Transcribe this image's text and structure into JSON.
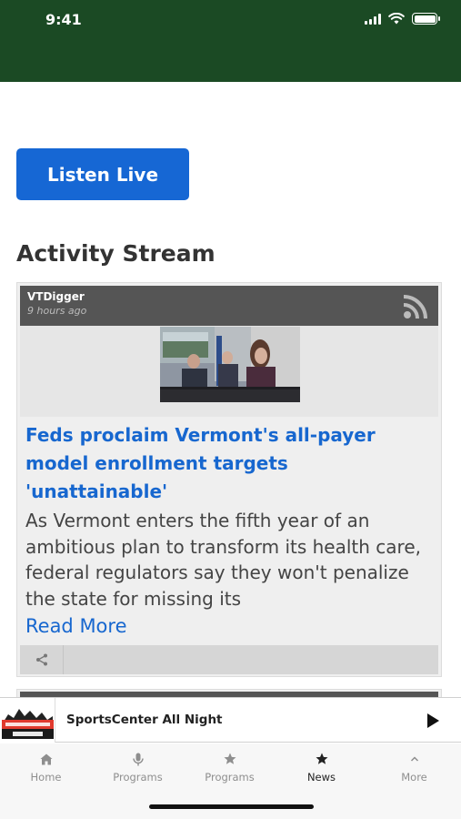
{
  "status_bar": {
    "time": "9:41",
    "background": "#1b4a24"
  },
  "listen_button": {
    "label": "Listen Live",
    "color": "#1667d4"
  },
  "section_title": "Activity Stream",
  "card": {
    "source": "VTDigger",
    "time_ago": "9 hours ago",
    "header_icon": "rss-icon",
    "title": "Feds proclaim Vermont's all-payer model enrollment targets 'unattainable'",
    "excerpt": "As Vermont enters the fifth year of an ambitious plan to transform its health care, federal regulators say they won't penalize the state for missing its",
    "read_more": "Read More",
    "footer_icon": "share-icon",
    "link_color": "#1767cf"
  },
  "now_playing": {
    "title": "SportsCenter All Night",
    "control_icon": "play-icon"
  },
  "tabs": [
    {
      "label": "Home",
      "icon": "home-icon"
    },
    {
      "label": "Programs",
      "icon": "microphone-icon"
    },
    {
      "label": "Programs",
      "icon": "star-icon"
    },
    {
      "label": "News",
      "icon": "star-icon",
      "active": true
    },
    {
      "label": "More",
      "icon": "chevron-up-icon"
    }
  ]
}
